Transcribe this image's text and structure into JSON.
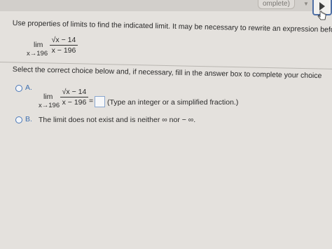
{
  "header": {
    "status_label": "omplete)",
    "status_caret": "▼"
  },
  "question": {
    "instruction": "Use properties of limits to find the indicated limit. It may be necessary to rewrite an expression before limit",
    "limit_word": "lim",
    "limit_sub": "x→196",
    "numerator": "√x − 14",
    "denominator": "x − 196"
  },
  "choices": {
    "prompt": "Select the correct choice below and, if necessary, fill in the answer box to complete your choice",
    "option_a": {
      "letter": "A.",
      "limit_word": "lim",
      "limit_sub": "x→196",
      "numerator": "√x − 14",
      "denominator": "x − 196",
      "equals": "=",
      "answer_value": "",
      "hint": "(Type an integer or a simplified fraction.)"
    },
    "option_b": {
      "letter": "B.",
      "text": "The limit does not exist and is neither ∞ nor − ∞."
    }
  }
}
